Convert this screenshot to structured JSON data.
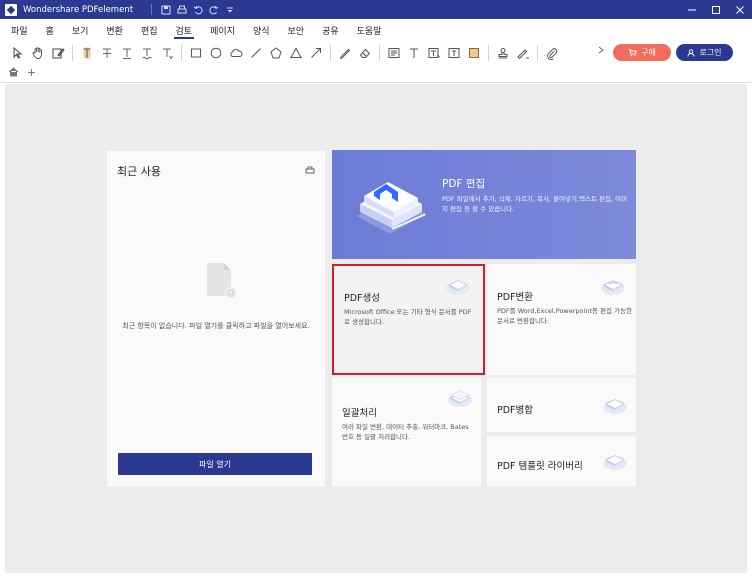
{
  "window": {
    "title": "Wondershare PDFelement"
  },
  "menu": {
    "items": [
      "파일",
      "홈",
      "보기",
      "변환",
      "편집",
      "검토",
      "페이지",
      "양식",
      "보안",
      "공유",
      "도움말"
    ],
    "active_index": 5
  },
  "toolbar": {
    "buy_label": "구매",
    "login_label": "로그인"
  },
  "recent": {
    "title": "최근 사용",
    "empty_message": "최근 항목이 없습니다. 파일 열기를 클릭하고 파일을 열어보세요.",
    "open_button": "파일 열기"
  },
  "hero": {
    "title": "PDF 편집",
    "description": "PDF 파일에서 추가, 삭제, 자르기, 복사, 붙여넣기,텍스트 편집, 이미지 편집 등 할 수 있습니다."
  },
  "cards": {
    "create": {
      "title": "PDF생성",
      "description": "Microsoft Office 또는 기타 형식 문서를 PDF로 생성합니다."
    },
    "convert": {
      "title": "PDF변환",
      "description": "PDF를 Word,Excel,Powerpoint등 편집 가능한 문서로 변환합니다."
    },
    "batch": {
      "title": "일괄처리",
      "description": "여러 파일 변환, 데이터 추출, 워터마크, Bates번호 등 일괄 처리합니다."
    },
    "merge": {
      "title": "PDF병합"
    },
    "templates": {
      "title": "PDF 템플릿 라이버리"
    }
  },
  "colors": {
    "brand": "#2b3990",
    "buy": "#f26b5b",
    "highlight_border": "#d01f2e",
    "hero": "#7584d8"
  }
}
